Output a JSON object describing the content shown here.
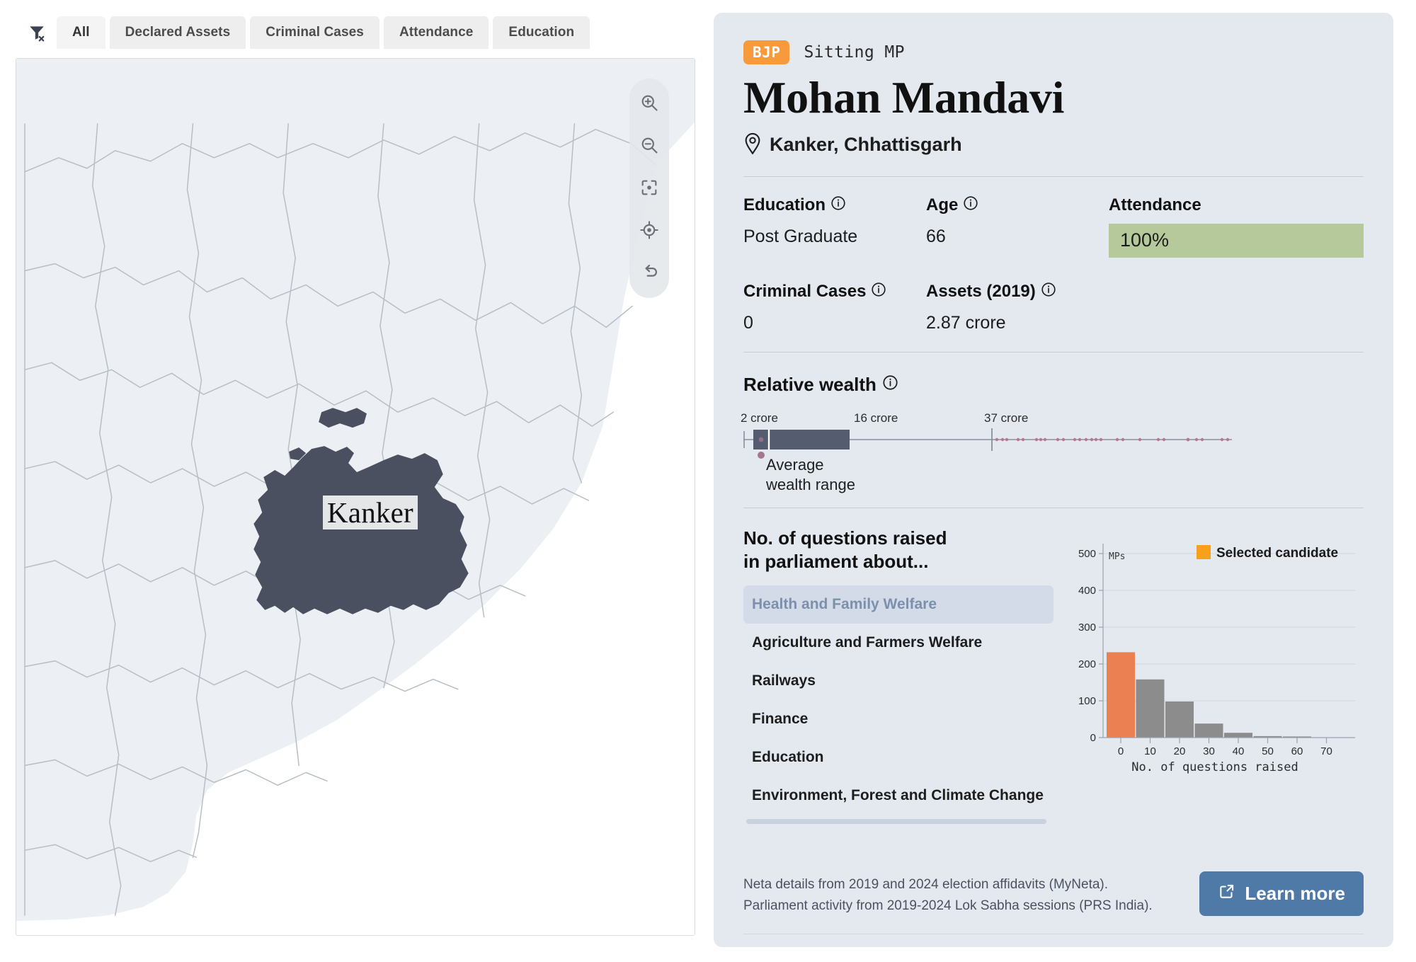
{
  "filters": {
    "clear_icon": "filter-remove-icon",
    "tabs": [
      {
        "label": "All",
        "active": true
      },
      {
        "label": "Declared Assets",
        "active": false
      },
      {
        "label": "Criminal Cases",
        "active": false
      },
      {
        "label": "Attendance",
        "active": false
      },
      {
        "label": "Education",
        "active": false
      }
    ]
  },
  "map": {
    "highlighted_district": "Kanker",
    "highlight_color": "#4b5060",
    "background_color": "#eceff3",
    "border_color": "#b8bec6",
    "controls": [
      {
        "name": "zoom-in-icon",
        "title": "Zoom in"
      },
      {
        "name": "zoom-out-icon",
        "title": "Zoom out"
      },
      {
        "name": "fit-bounds-icon",
        "title": "Fit to bounds"
      },
      {
        "name": "locate-icon",
        "title": "Locate"
      },
      {
        "name": "reset-icon",
        "title": "Reset"
      }
    ]
  },
  "candidate": {
    "party": "BJP",
    "party_color": "#f79a3b",
    "status": "Sitting MP",
    "name": "Mohan Mandavi",
    "constituency": "Kanker, Chhattisgarh"
  },
  "stats": {
    "education_label": "Education",
    "education_value": "Post Graduate",
    "age_label": "Age",
    "age_value": "66",
    "attendance_label": "Attendance",
    "attendance_value": "100%",
    "attendance_color": "#b5c99a",
    "criminal_label": "Criminal Cases",
    "criminal_value": "0",
    "assets_label": "Assets (2019)",
    "assets_value": "2.87 crore"
  },
  "wealth": {
    "title": "Relative wealth",
    "tick_low": "2 crore",
    "tick_mid": "16 crore",
    "tick_high": "37 crore",
    "average_note_line1": "Average",
    "average_note_line2": "wealth range",
    "box_color": "#555c70",
    "marker_color": "#a5768f"
  },
  "questions": {
    "title_line1": "No. of questions raised",
    "title_line2": "in parliament about...",
    "topics": [
      {
        "label": "Health and Family Welfare",
        "selected": true
      },
      {
        "label": "Agriculture and Farmers Welfare",
        "selected": false
      },
      {
        "label": "Railways",
        "selected": false
      },
      {
        "label": "Finance",
        "selected": false
      },
      {
        "label": "Education",
        "selected": false
      },
      {
        "label": "Environment, Forest and Climate Change",
        "selected": false
      }
    ]
  },
  "chart_data": {
    "type": "bar",
    "title": "",
    "xlabel": "No. of questions raised",
    "ylabel": "MPs",
    "xlim": [
      -5,
      78
    ],
    "ylim": [
      0,
      500
    ],
    "xticks": [
      0,
      10,
      20,
      30,
      40,
      50,
      60,
      70
    ],
    "yticks": [
      0,
      100,
      200,
      300,
      400,
      500
    ],
    "bin_width": 10,
    "bin_starts": [
      -5,
      5,
      15,
      25,
      35,
      45,
      55,
      65
    ],
    "values": [
      232,
      158,
      98,
      38,
      13,
      4,
      3,
      1
    ],
    "highlight_index": 0,
    "highlight_color": "#eb8052",
    "bar_color": "#8c8c8c",
    "legend": {
      "label": "Selected candidate",
      "color": "#f9a01b",
      "position": "top-right"
    },
    "grid": true
  },
  "footer": {
    "source_line1": "Neta details from 2019 and 2024 election affidavits (MyNeta).",
    "source_line2": "Parliament activity from 2019-2024 Lok Sabha sessions (PRS India).",
    "learn_more": "Learn more",
    "learn_more_icon": "external-link-icon",
    "button_color": "#4f7aa8"
  }
}
